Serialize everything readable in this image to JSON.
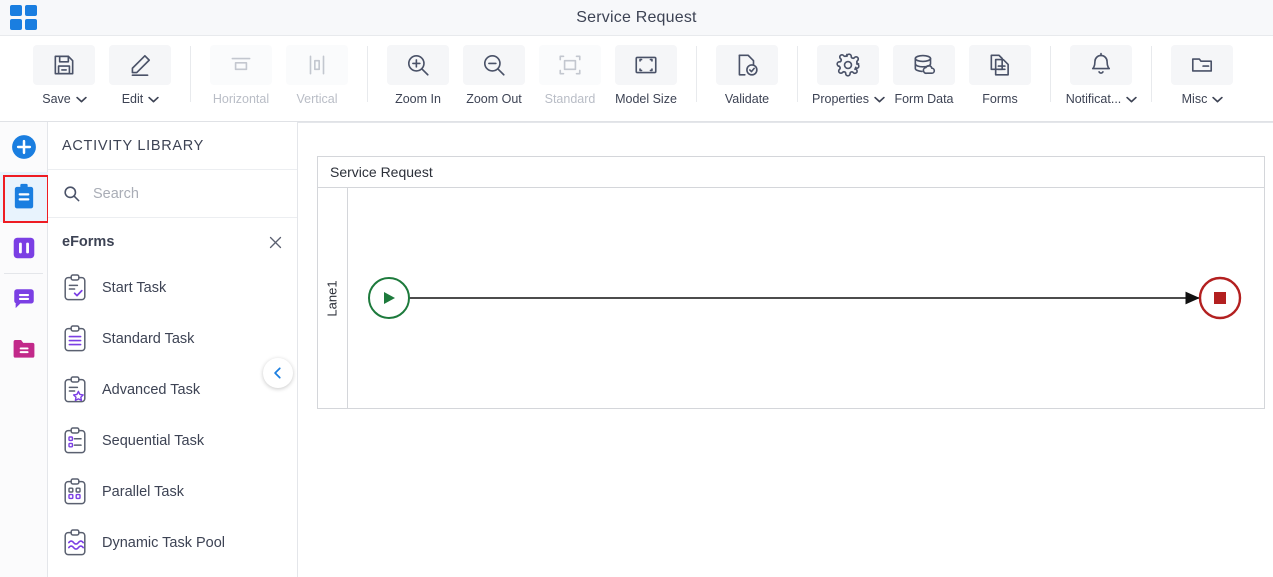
{
  "titlebar": {
    "app_icon": "grid-apps-icon",
    "title": "Service Request"
  },
  "toolbar": {
    "groups": [
      {
        "items": [
          {
            "label": "Save",
            "icon": "save-floppy-icon",
            "caret": true,
            "disabled": false
          },
          {
            "label": "Edit",
            "icon": "pencil-edit-icon",
            "caret": true,
            "disabled": false
          }
        ]
      },
      {
        "items": [
          {
            "label": "Horizontal",
            "icon": "align-horizontal-icon",
            "caret": false,
            "disabled": true
          },
          {
            "label": "Vertical",
            "icon": "align-vertical-icon",
            "caret": false,
            "disabled": true
          }
        ]
      },
      {
        "items": [
          {
            "label": "Zoom In",
            "icon": "zoom-in-icon",
            "caret": false,
            "disabled": false
          },
          {
            "label": "Zoom Out",
            "icon": "zoom-out-icon",
            "caret": false,
            "disabled": false
          },
          {
            "label": "Standard",
            "icon": "standard-size-icon",
            "caret": false,
            "disabled": true
          },
          {
            "label": "Model Size",
            "icon": "model-size-icon",
            "caret": false,
            "disabled": false
          }
        ]
      },
      {
        "items": [
          {
            "label": "Validate",
            "icon": "validate-doc-check-icon",
            "caret": false,
            "disabled": false
          }
        ]
      },
      {
        "items": [
          {
            "label": "Properties",
            "icon": "gear-icon",
            "caret": true,
            "disabled": false
          },
          {
            "label": "Form Data",
            "icon": "database-cloud-icon",
            "caret": false,
            "disabled": false
          },
          {
            "label": "Forms",
            "icon": "forms-pages-icon",
            "caret": false,
            "disabled": false
          }
        ]
      },
      {
        "items": [
          {
            "label": "Notificat...",
            "icon": "bell-icon",
            "caret": true,
            "disabled": false
          }
        ]
      },
      {
        "items": [
          {
            "label": "Misc",
            "icon": "folder-misc-icon",
            "caret": true,
            "disabled": false
          }
        ]
      }
    ]
  },
  "rail": {
    "items": [
      {
        "name": "add-button",
        "icon": "plus-circle-icon",
        "color": "#1a7ee0",
        "active": false,
        "selected": false
      },
      {
        "name": "activity-library",
        "icon": "clipboard-icon",
        "color": "#1a7ee0",
        "active": true,
        "selected": true
      },
      {
        "name": "columns-panel",
        "icon": "columns-icon",
        "color": "#7b3fe4",
        "active": false,
        "selected": false
      },
      {
        "name": "comments-panel",
        "icon": "chat-bubble-icon",
        "color": "#7b3fe4",
        "active": false,
        "selected": false
      },
      {
        "name": "files-panel",
        "icon": "folder-icon",
        "color": "#c2298a",
        "active": false,
        "selected": false
      }
    ]
  },
  "panel": {
    "title": "ACTIVITY LIBRARY",
    "search": {
      "value": "",
      "placeholder": "Search",
      "icon": "search-icon"
    },
    "group": {
      "label": "eForms",
      "close_icon": "close-icon"
    },
    "items": [
      {
        "label": "Start Task",
        "icon": "clipboard-check-icon"
      },
      {
        "label": "Standard Task",
        "icon": "clipboard-lines-icon"
      },
      {
        "label": "Advanced Task",
        "icon": "clipboard-star-icon"
      },
      {
        "label": "Sequential Task",
        "icon": "clipboard-sequential-icon"
      },
      {
        "label": "Parallel Task",
        "icon": "clipboard-parallel-icon"
      },
      {
        "label": "Dynamic Task Pool",
        "icon": "clipboard-wave-icon"
      }
    ],
    "collapse_handle": {
      "icon": "chevron-left-icon"
    }
  },
  "canvas": {
    "pool": {
      "title": "Service Request",
      "lane": {
        "label": "Lane1"
      },
      "nodes": [
        {
          "name": "start-event",
          "type": "start",
          "glyph": "play-triangle",
          "color": "#1d7a3c"
        },
        {
          "name": "end-event",
          "type": "end",
          "glyph": "stop-square",
          "color": "#b32020"
        }
      ],
      "connector": {
        "name": "sequence-flow",
        "from": "start-event",
        "to": "end-event"
      }
    }
  },
  "colors": {
    "accent_blue": "#1a7ee0",
    "accent_purple": "#7b3fe4",
    "accent_magenta": "#c2298a",
    "selection_red": "#ee1c23",
    "start_green": "#1d7a3c",
    "end_red": "#b32020"
  }
}
